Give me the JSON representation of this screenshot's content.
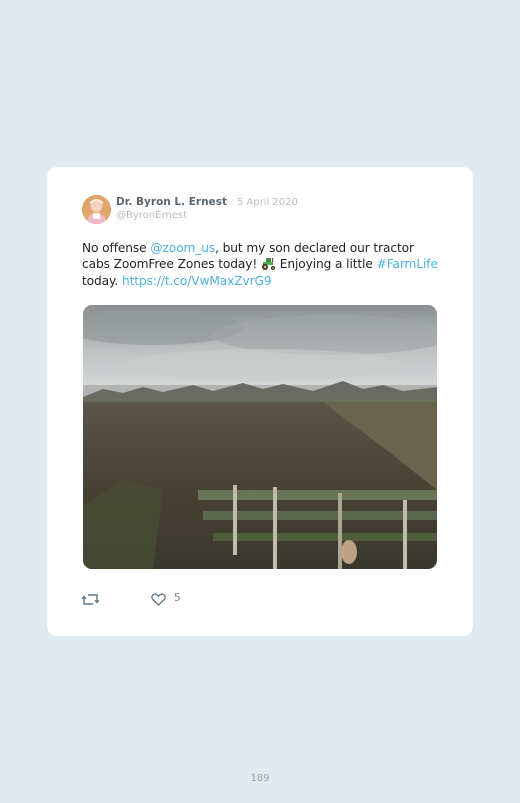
{
  "tweet": {
    "author_name": "Dr. Byron L. Ernest",
    "separator": "·",
    "date": "5 April 2020",
    "handle": "@ByronErnest",
    "text_parts": {
      "p1": "No offense ",
      "mention": "@zoom_us",
      "p2": ", but my son declared our tractor cabs ZoomFree Zones today! ",
      "emoji": "tractor-emoji",
      "p3": " Enjoying a little ",
      "hashtag": "#FarmLife",
      "p4": " today. ",
      "url": "https://t.co/VwMaxZvrG9"
    },
    "like_count": "5"
  },
  "icons": {
    "retweet": "retweet-icon",
    "like": "heart-icon"
  },
  "colors": {
    "background": "#dfeaf3",
    "card": "#ffffff",
    "link": "#4fb1e3",
    "text": "#1f2328",
    "muted": "#b5bec6"
  },
  "page_number": "189"
}
